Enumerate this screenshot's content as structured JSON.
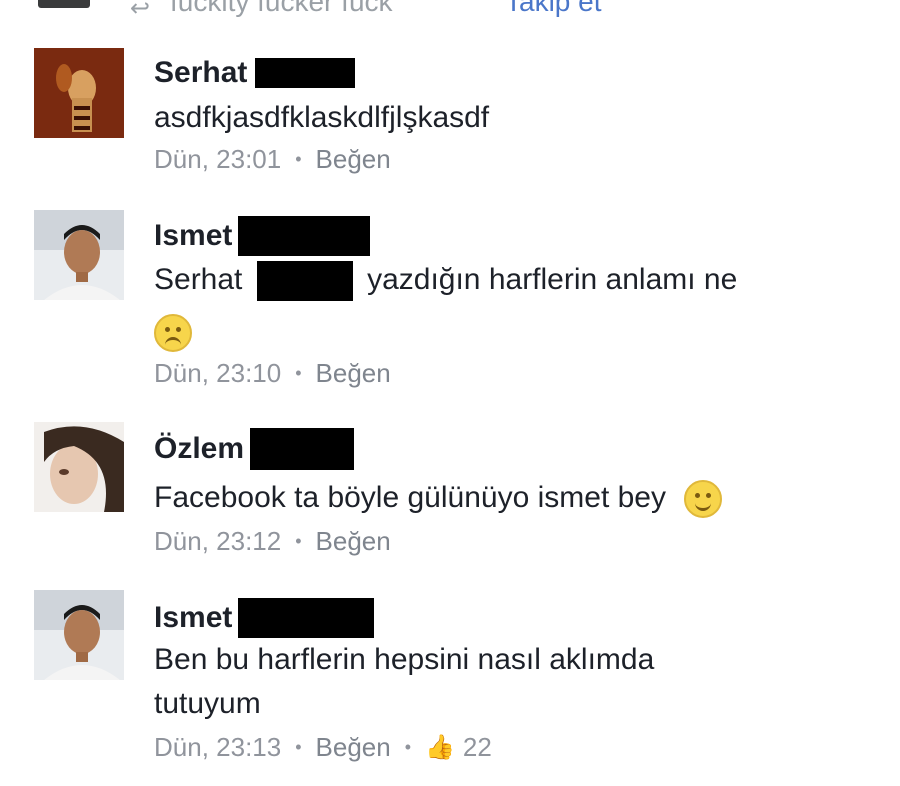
{
  "top_bar": {
    "text": "fuckity fucker fuck",
    "follow_link": "Takip et",
    "share_icon": "share-arrow-icon"
  },
  "comments": [
    {
      "name": "Serhat",
      "text": "asdfkjasdfklaskdlfjlşkasdf",
      "time": "Dün, 23:01",
      "like_label": "Beğen"
    },
    {
      "name": "Ismet",
      "mention": "Serhat",
      "text_after_mention": "yazdığın harflerin anlamı ne",
      "emoji": "sad-face-icon",
      "time": "Dün, 23:10",
      "like_label": "Beğen"
    },
    {
      "name": "Özlem",
      "text": "Facebook ta böyle gülünüyo ismet bey",
      "emoji": "smile-face-icon",
      "time": "Dün, 23:12",
      "like_label": "Beğen"
    },
    {
      "name": "Ismet",
      "text_line1": "Ben bu harflerin hepsini nasıl aklımda",
      "text_line2": "tutuyum",
      "time": "Dün, 23:13",
      "like_label": "Beğen",
      "like_icon": "thumbs-up-icon",
      "like_count": "22"
    }
  ],
  "colors": {
    "name": "#1d2129",
    "meta": "#90949c",
    "link": "#4a76c9",
    "redaction": "#000000"
  }
}
